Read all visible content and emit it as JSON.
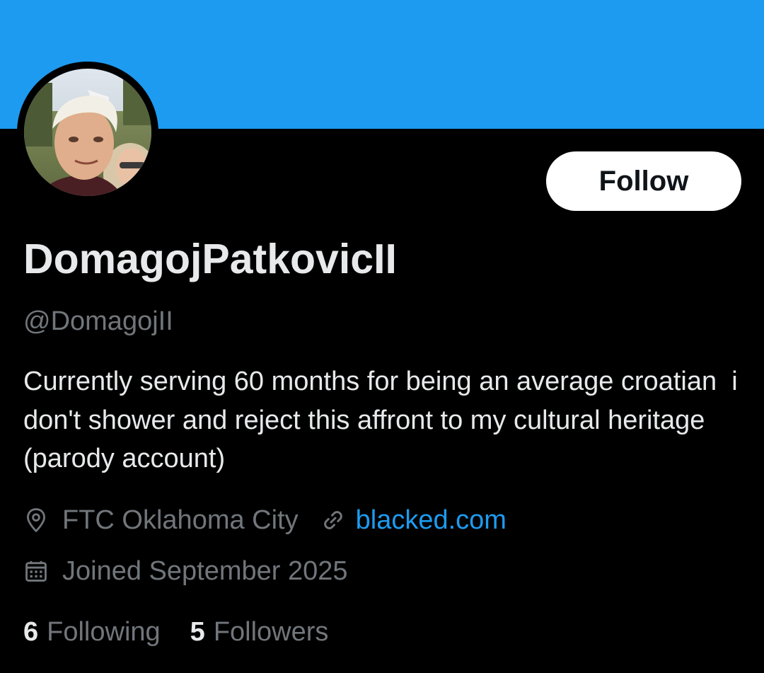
{
  "colors": {
    "banner": "#1d9bf0",
    "background": "#000000",
    "primary_text": "#e7e9ea",
    "secondary_text": "#71767b",
    "link": "#1d9bf0",
    "follow_button_bg": "#ffffff",
    "follow_button_text": "#0f1419"
  },
  "profile": {
    "display_name": "DomagojPatkovicII",
    "handle": "@DomagojII",
    "bio": "Currently serving 60 months for being an average croatian  i don't shower and reject this affront to my cultural heritage (parody account)",
    "avatar_icon": "profile-photo"
  },
  "actions": {
    "follow_label": "Follow"
  },
  "meta": {
    "location_icon": "location-pin-icon",
    "location": "FTC Oklahoma City",
    "link_icon": "link-icon",
    "website": "blacked.com",
    "joined_icon": "calendar-icon",
    "joined": "Joined September 2025"
  },
  "stats": {
    "following_count": "6",
    "following_label": "Following",
    "followers_count": "5",
    "followers_label": "Followers"
  }
}
